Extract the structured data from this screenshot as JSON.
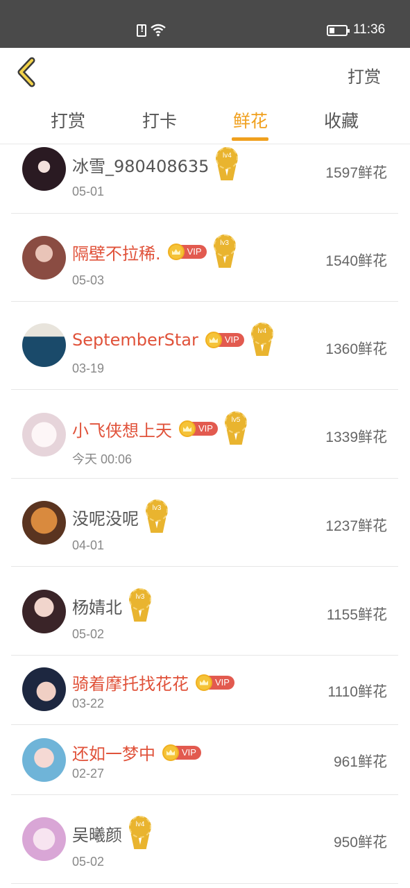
{
  "status_bar": {
    "time": "11:36"
  },
  "header": {
    "action_label": "打赏"
  },
  "tabs": [
    {
      "label": "打赏",
      "active": false
    },
    {
      "label": "打卡",
      "active": false
    },
    {
      "label": "鲜花",
      "active": true
    },
    {
      "label": "收藏",
      "active": false
    }
  ],
  "colors": {
    "accent": "#f0a01e",
    "vip_name": "#e0523a",
    "vip_badge": "#e25a4f"
  },
  "rows": [
    {
      "name": "冰雪_980408635",
      "vip": false,
      "vip_label": "",
      "level": "lv4",
      "date": "05-01",
      "count": "1597鲜花"
    },
    {
      "name": "隔壁不拉稀.",
      "vip": true,
      "vip_label": "VIP",
      "level": "lv3",
      "date": "05-03",
      "count": "1540鲜花"
    },
    {
      "name": "SeptemberStar",
      "vip": true,
      "vip_label": "VIP",
      "level": "lv4",
      "date": "03-19",
      "count": "1360鲜花"
    },
    {
      "name": "小飞侠想上天",
      "vip": true,
      "vip_label": "VIP",
      "level": "lv5",
      "date": "今天 00:06",
      "count": "1339鲜花"
    },
    {
      "name": "没呢没呢",
      "vip": false,
      "vip_label": "",
      "level": "lv3",
      "date": "04-01",
      "count": "1237鲜花"
    },
    {
      "name": "杨婧北",
      "vip": false,
      "vip_label": "",
      "level": "lv3",
      "date": "05-02",
      "count": "1155鲜花"
    },
    {
      "name": "骑着摩托找花花",
      "vip": true,
      "vip_label": "VIP",
      "level": "",
      "date": "03-22",
      "count": "1110鲜花"
    },
    {
      "name": "还如一梦中",
      "vip": true,
      "vip_label": "VIP",
      "level": "",
      "date": "02-27",
      "count": "961鲜花"
    },
    {
      "name": "吴曦颜",
      "vip": false,
      "vip_label": "",
      "level": "lv4",
      "date": "05-02",
      "count": "950鲜花"
    }
  ]
}
